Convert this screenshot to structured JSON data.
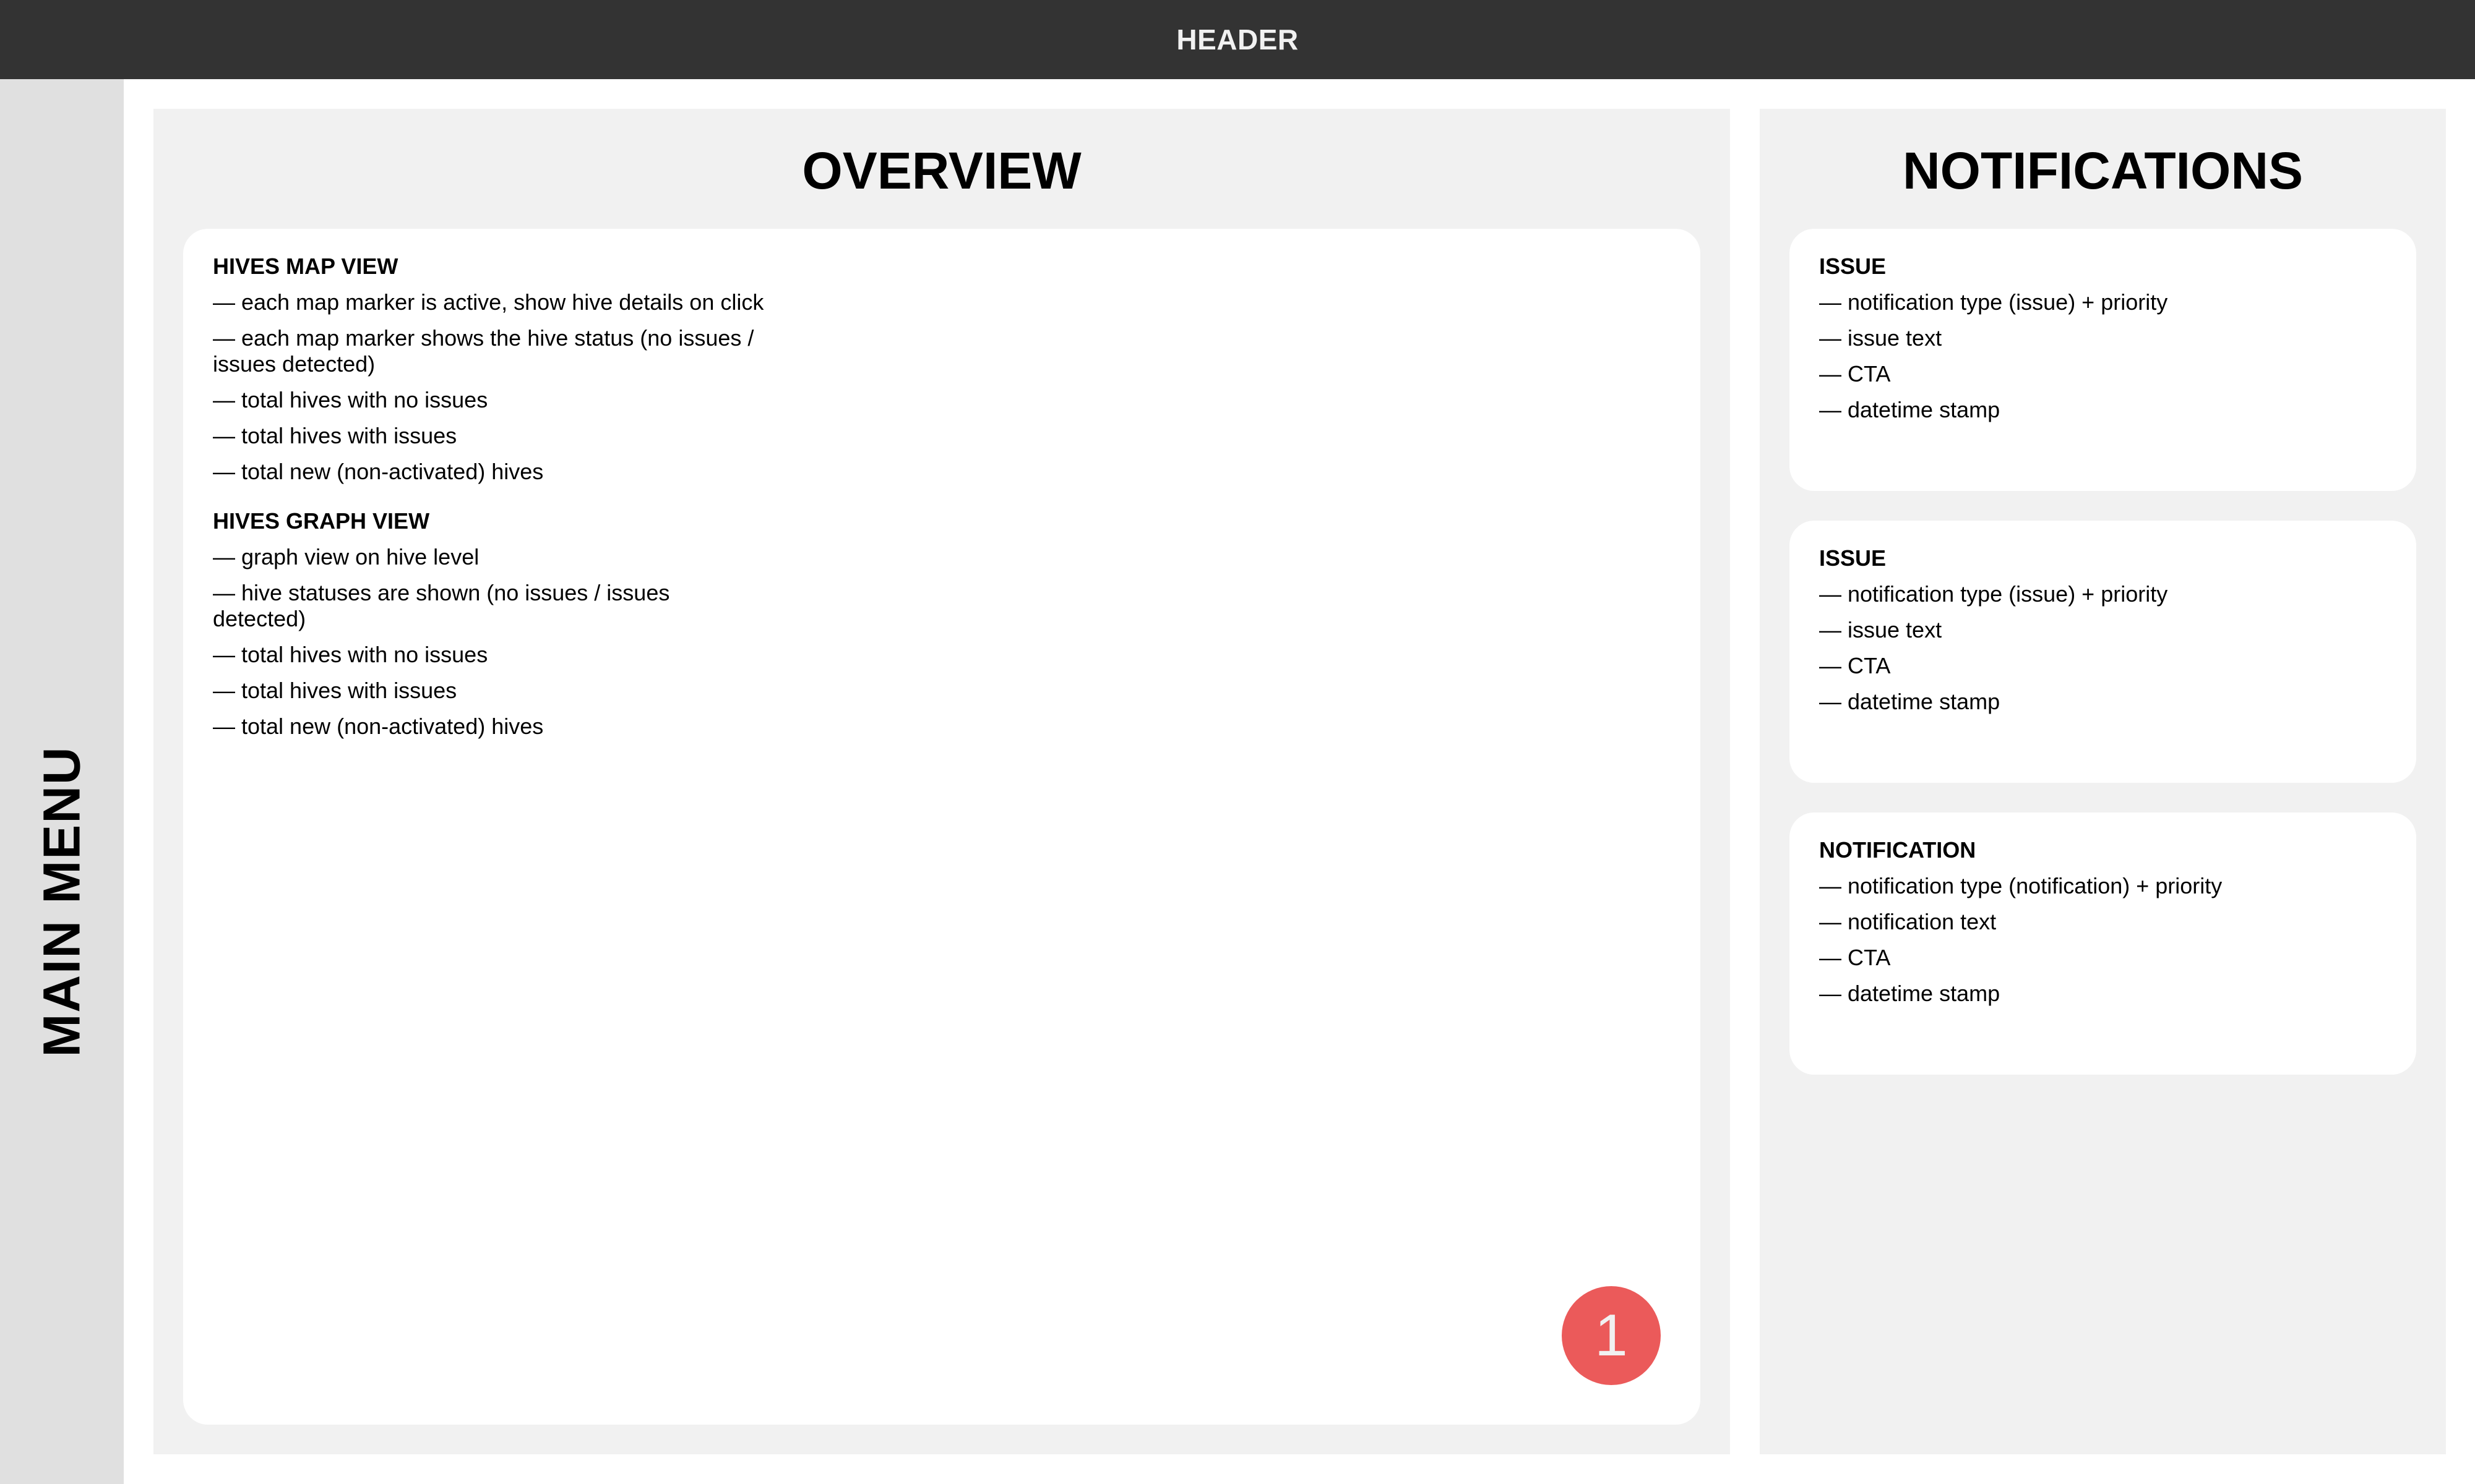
{
  "header": {
    "title": "HEADER"
  },
  "sidebar": {
    "label": "MAIN MENU"
  },
  "overview": {
    "title": "OVERVIEW",
    "sections": [
      {
        "title": "HIVES MAP VIEW",
        "items": [
          "— each map marker is active, show hive details on click",
          "— each map marker shows the hive status (no issues / issues detected)",
          "— total hives with no issues",
          "— total hives with issues",
          "— total new (non-activated) hives"
        ]
      },
      {
        "title": "HIVES GRAPH VIEW",
        "items": [
          "— graph view on hive level",
          "— hive statuses are shown (no issues / issues detected)",
          "— total hives with no issues",
          "— total hives with issues",
          "— total new (non-activated) hives"
        ]
      }
    ],
    "badge": {
      "value": "1",
      "color": "#eb5a5a"
    }
  },
  "notifications": {
    "title": "NOTIFICATIONS",
    "cards": [
      {
        "title": "ISSUE",
        "items": [
          "— notification type (issue) + priority",
          "— issue text",
          "— CTA",
          "— datetime stamp"
        ]
      },
      {
        "title": "ISSUE",
        "items": [
          "— notification type (issue) + priority",
          "— issue text",
          "— CTA",
          "— datetime stamp"
        ]
      },
      {
        "title": "NOTIFICATION",
        "items": [
          "— notification type (notification) + priority",
          "— notification text",
          "— CTA",
          "— datetime stamp"
        ]
      }
    ]
  }
}
